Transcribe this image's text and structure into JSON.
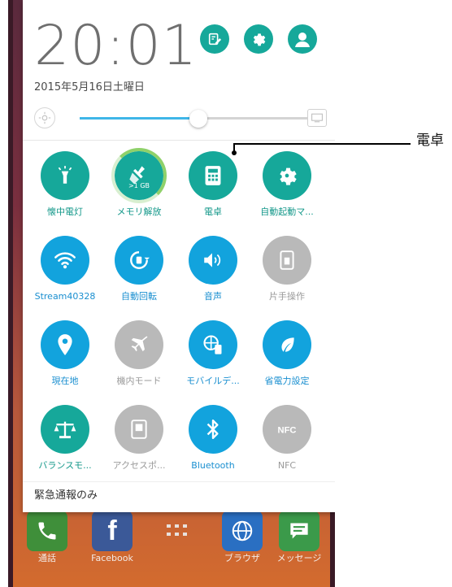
{
  "status": {
    "time": "20:01",
    "date": "2015年5月16日土曜日"
  },
  "brightness": {
    "level": 0.52
  },
  "tiles": [
    {
      "label": "懐中電灯",
      "state": "on",
      "icon": "flashlight-icon"
    },
    {
      "label": "メモリ解放",
      "state": "on",
      "icon": "broom-icon",
      "badge": ">1 GB"
    },
    {
      "label": "電卓",
      "state": "on",
      "icon": "calculator-icon"
    },
    {
      "label": "自動起動マ...",
      "state": "on",
      "icon": "auto-start-gear-icon"
    },
    {
      "label": "Stream40328",
      "state": "on",
      "icon": "wifi-icon"
    },
    {
      "label": "自動回転",
      "state": "on",
      "icon": "auto-rotate-icon"
    },
    {
      "label": "音声",
      "state": "on",
      "icon": "volume-icon"
    },
    {
      "label": "片手操作",
      "state": "off",
      "icon": "one-hand-icon"
    },
    {
      "label": "現在地",
      "state": "on",
      "icon": "location-pin-icon"
    },
    {
      "label": "機内モード",
      "state": "off",
      "icon": "airplane-icon"
    },
    {
      "label": "モバイルデ...",
      "state": "on",
      "icon": "mobile-data-icon"
    },
    {
      "label": "省電力設定",
      "state": "on",
      "icon": "leaf-icon"
    },
    {
      "label": "バランスモ...",
      "state": "on",
      "icon": "balance-icon"
    },
    {
      "label": "アクセスポ...",
      "state": "off",
      "icon": "access-point-icon"
    },
    {
      "label": "Bluetooth",
      "state": "on",
      "icon": "bluetooth-icon"
    },
    {
      "label": "NFC",
      "state": "off",
      "icon": "nfc-icon"
    }
  ],
  "emergency_text": "緊急通報のみ",
  "dock": [
    {
      "label": "通話",
      "icon": "phone-icon",
      "color": "#3f8f3a"
    },
    {
      "label": "Facebook",
      "icon": "facebook-icon",
      "color": "#3b5998"
    },
    {
      "label": "",
      "icon": "app-drawer-icon",
      "color": "transparent"
    },
    {
      "label": "ブラウザ",
      "icon": "globe-icon",
      "color": "#2a6fc2"
    },
    {
      "label": "メッセージ",
      "icon": "message-icon",
      "color": "#3b9a4a"
    }
  ],
  "callout": {
    "label": "電卓"
  },
  "colors": {
    "accent_green": "#16a89a",
    "accent_blue": "#12a3dd",
    "off_gray": "#b9b9b9",
    "label_green": "#14988a",
    "label_blue": "#1a8fd0"
  }
}
